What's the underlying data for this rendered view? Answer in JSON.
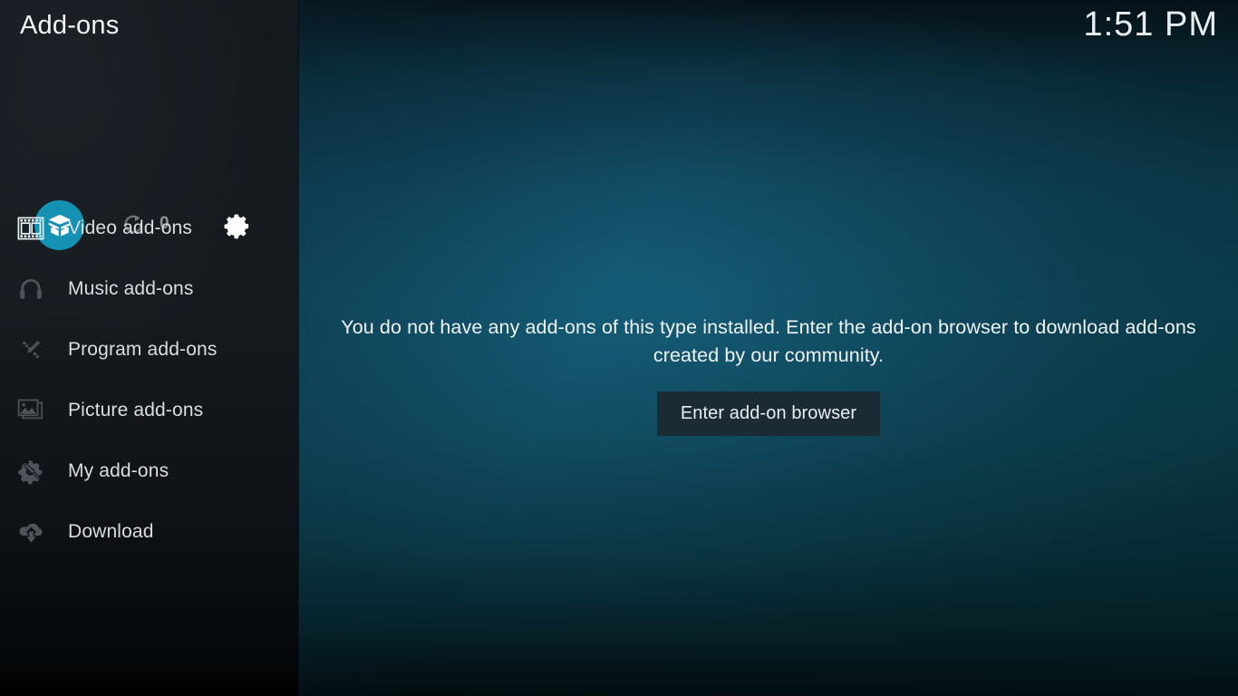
{
  "window": {
    "title": "Add-ons",
    "clock": "1:51 PM"
  },
  "colors": {
    "accent": "#1591b4",
    "sidebar_bg": "#14191e",
    "main_bg": "#0d4455",
    "button_bg": "#1b2b33",
    "label_text": "#d9dee1",
    "icon_dim": "#4d5358",
    "icon_selected": "#e9f4f7"
  },
  "controls": {
    "addon_badge_icon": "open-box-icon",
    "refresh_icon": "refresh-icon",
    "update_count": "0",
    "settings_icon": "gear-icon"
  },
  "menu": {
    "items": [
      {
        "label": "Video add-ons",
        "icon": "filmstrip-icon",
        "selected": true
      },
      {
        "label": "Music add-ons",
        "icon": "headphones-icon",
        "selected": false
      },
      {
        "label": "Program add-ons",
        "icon": "pencil-wrench-icon",
        "selected": false
      },
      {
        "label": "Picture add-ons",
        "icon": "picture-frame-icon",
        "selected": false
      },
      {
        "label": "My add-ons",
        "icon": "gear-screwdriver-icon",
        "selected": false
      },
      {
        "label": "Download",
        "icon": "cloud-download-icon",
        "selected": false
      }
    ]
  },
  "main": {
    "empty_message": "You do not have any add-ons of this type installed. Enter the add-on browser to download add-ons created by our community.",
    "enter_browser_label": "Enter add-on browser"
  }
}
